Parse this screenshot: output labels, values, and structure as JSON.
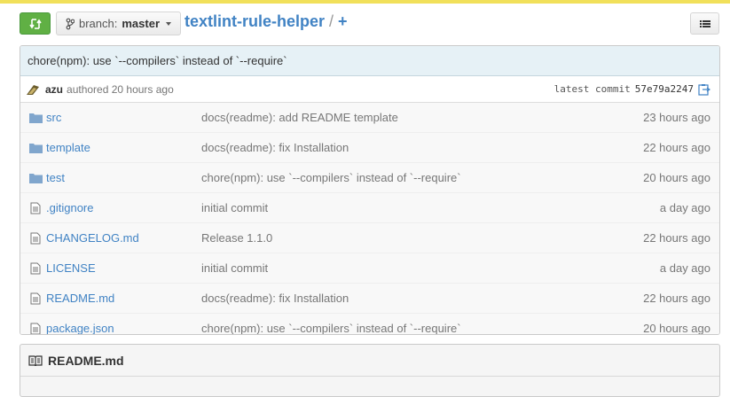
{
  "colors": {
    "accent": "#4183c4",
    "compare_green": "#60b044",
    "commit_bar": "#e6f1f6",
    "top_bar": "#f1e05a"
  },
  "toolbar": {
    "compare_icon": "compare-arrows-icon",
    "branch_icon": "branch-icon",
    "branch_prefix": "branch:",
    "branch_name": "master",
    "list_icon": "list-icon"
  },
  "breadcrumb": {
    "repo": "textlint-rule-helper",
    "separator": "/",
    "add": "+"
  },
  "commit": {
    "message": "chore(npm): use `--compilers` instead of `--require`",
    "author": "azu",
    "authored": "authored 20 hours ago",
    "latest_label": "latest commit",
    "sha": "57e79a2247",
    "copy_icon": "clipboard-icon"
  },
  "files": [
    {
      "type": "dir",
      "name": "src",
      "message": "docs(readme): add README template",
      "age": "23 hours ago"
    },
    {
      "type": "dir",
      "name": "template",
      "message": "docs(readme): fix Installation",
      "age": "22 hours ago"
    },
    {
      "type": "dir",
      "name": "test",
      "message": "chore(npm): use `--compilers` instead of `--require`",
      "age": "20 hours ago"
    },
    {
      "type": "file",
      "name": ".gitignore",
      "message": "initial commit",
      "age": "a day ago"
    },
    {
      "type": "file",
      "name": "CHANGELOG.md",
      "message": "Release 1.1.0",
      "age": "22 hours ago"
    },
    {
      "type": "file",
      "name": "LICENSE",
      "message": "initial commit",
      "age": "a day ago"
    },
    {
      "type": "file",
      "name": "README.md",
      "message": "docs(readme): fix Installation",
      "age": "22 hours ago"
    },
    {
      "type": "file",
      "name": "package.json",
      "message": "chore(npm): use `--compilers` instead of `--require`",
      "age": "20 hours ago"
    }
  ],
  "readme": {
    "icon": "book-icon",
    "title": "README.md"
  }
}
